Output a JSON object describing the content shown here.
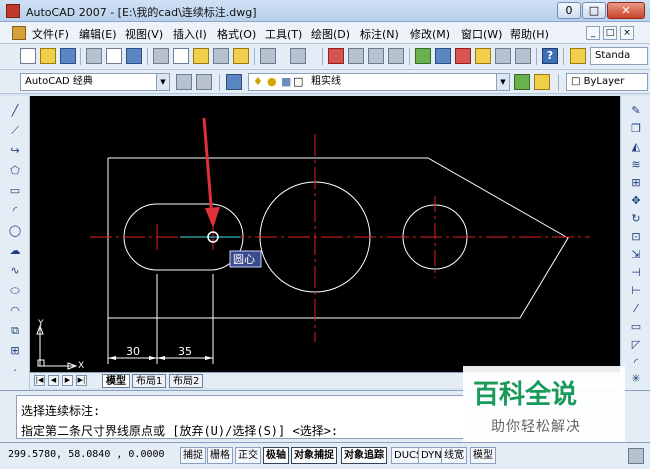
{
  "window": {
    "title": "AutoCAD 2007 - [E:\\我的cad\\连续标注.dwg]",
    "min_label": "0",
    "max_label": "□",
    "close_label": "✕"
  },
  "menu": {
    "items": [
      "文件(F)",
      "编辑(E)",
      "视图(V)",
      "插入(I)",
      "格式(O)",
      "工具(T)",
      "绘图(D)",
      "标注(N)",
      "修改(M)",
      "窗口(W)",
      "帮助(H)"
    ],
    "mdi_controls": [
      "_",
      "□",
      "×"
    ]
  },
  "toolbar": {
    "text_style": "Standa",
    "help_label": "?"
  },
  "toolbar2": {
    "workspace": "AutoCAD 经典",
    "layer": "粗实线",
    "bylayer": "ByLayer"
  },
  "drawing": {
    "tooltip": "圆心",
    "dim_30": "30",
    "dim_35": "35",
    "ucs_x": "X",
    "ucs_y": "Y"
  },
  "tabs": {
    "model": "模型",
    "layout1": "布局1",
    "layout2": "布局2"
  },
  "command": {
    "line1": "选择连续标注:",
    "line2": "指定第二条尺寸界线原点或 [放弃(U)/选择(S)] <选择>:"
  },
  "status": {
    "coords": "299.5780, 58.0840 , 0.0000",
    "buttons": [
      "捕捉",
      "栅格",
      "正交",
      "极轴",
      "对象捕捉",
      "对象追踪",
      "DUCS",
      "DYN",
      "线宽",
      "模型"
    ]
  },
  "watermark": {
    "logo": "百科全说",
    "sub": "助你轻松解决"
  },
  "colors": {
    "canvas": "#000000",
    "geometry": "#ffffff",
    "centerline": "#e02020",
    "arrow": "#e0303a",
    "tooltip_bg": "#3a4a8c",
    "watermark_green": "#1a9a5a"
  }
}
